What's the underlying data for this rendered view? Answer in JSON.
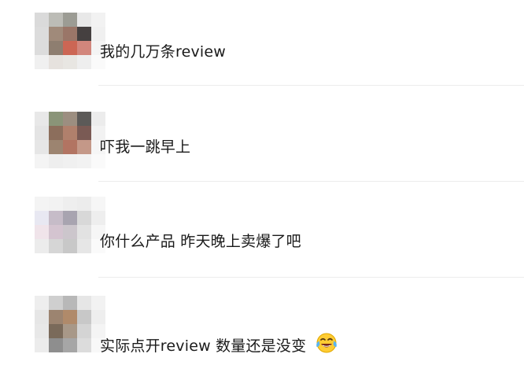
{
  "comments": [
    {
      "text": "我的几万条review",
      "avatar_colors": [
        "#dadada",
        "#bcbcb6",
        "#9c9c94",
        "#e8e8e8",
        "#f2f2f2",
        "#dcdcdc",
        "#a08a7a",
        "#9a7668",
        "#454040",
        "#f0f0f0",
        "#dcdcdc",
        "#8e7e70",
        "#cc6654",
        "#d2867c",
        "#f4f4f4",
        "#f0f0f0",
        "#e6e2de",
        "#e8e6e2",
        "#eeeeee",
        "#fafafa"
      ]
    },
    {
      "text": "吓我一跳早上",
      "avatar_colors": [
        "#e8e8e8",
        "#8a9478",
        "#9c8e80",
        "#5c5a58",
        "#ececec",
        "#e4e4e4",
        "#8c6e5c",
        "#b0806c",
        "#7a5a54",
        "#f2f2f2",
        "#e6e6e6",
        "#9c8470",
        "#b27462",
        "#c49888",
        "#f6f6f6",
        "#f4f4f4",
        "#eeeeee",
        "#f0f0f0",
        "#f2f2f2",
        "#fafafa"
      ]
    },
    {
      "text": "你什么产品 昨天晚上卖爆了吧",
      "avatar_colors": [
        "#f4f4f4",
        "#f2f2f2",
        "#eeeeee",
        "#ececec",
        "#f6f6f6",
        "#e8e8f2",
        "#c6bcc8",
        "#a8a4b0",
        "#d8d8d8",
        "#eeeeee",
        "#f0e4ea",
        "#d4c4d0",
        "#ccc6cc",
        "#e2e2e2",
        "#f6f6f6",
        "#ececec",
        "#d6d6d6",
        "#c8c8c8",
        "#e6e6e6",
        "#fafafa"
      ]
    },
    {
      "text": "实际点开review 数量还是没变",
      "emoji": "laughing-tears-emoji",
      "avatar_colors": [
        "#eeeeee",
        "#cfcfcf",
        "#b8b8b8",
        "#e6e6e6",
        "#f2f2f2",
        "#e6e6e6",
        "#9c8470",
        "#b08a6a",
        "#c8c8c8",
        "#eeeeee",
        "#e8e8e8",
        "#7a6a5a",
        "#a89888",
        "#d4d4d4",
        "#f4f4f4",
        "#ececec",
        "#8e8e8e",
        "#a6a6a6",
        "#dcdcdc",
        "#f8f8f8"
      ]
    }
  ]
}
